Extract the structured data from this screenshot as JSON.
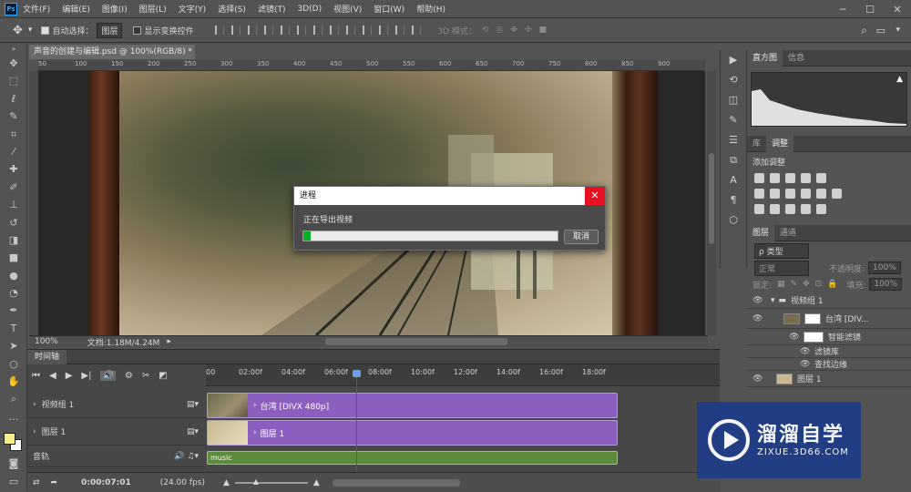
{
  "menubar": {
    "app_icon": "Ps",
    "items": [
      "文件(F)",
      "编辑(E)",
      "图像(I)",
      "图层(L)",
      "文字(Y)",
      "选择(S)",
      "滤镜(T)",
      "3D(D)",
      "视图(V)",
      "窗口(W)",
      "帮助(H)"
    ],
    "window_controls": [
      "─",
      "☐",
      "✕"
    ]
  },
  "options": {
    "auto_select_label": "自动选择：",
    "auto_select_value": "图层",
    "transform_label": "显示变换控件",
    "mode3d_label": "3D 模式："
  },
  "document": {
    "tab_title": "声音的创建与编辑.psd @ 100%(RGB/8) *",
    "tab_close": "×",
    "zoom": "100%",
    "docsize": "文档:1.18M/4.24M"
  },
  "ruler": {
    "marks": [
      "50",
      "100",
      "150",
      "200",
      "250",
      "300",
      "350",
      "400",
      "450",
      "500",
      "550",
      "600",
      "650",
      "700",
      "750",
      "800",
      "850",
      "900"
    ]
  },
  "dialog": {
    "title": "进程",
    "message": "正在导出视频",
    "progress": 0.03,
    "cancel_label": "取消",
    "close_icon": "✕"
  },
  "right_panel": {
    "tabs1": [
      "直方图",
      "信息"
    ],
    "tabs2": [
      "库",
      "调整"
    ],
    "adjust_label": "添加调整",
    "tabs3": [
      "图层",
      "通道"
    ],
    "kind_filter": "ρ 类型",
    "blend_mode": "正常",
    "opacity_label": "不透明度:",
    "opacity_value": "100%",
    "lock_label": "锁定:",
    "fill_label": "填充:",
    "fill_value": "100%",
    "layers": [
      {
        "name": "视频组 1",
        "type": "group"
      },
      {
        "name": "台湾 [DIV...",
        "type": "smart"
      },
      {
        "name": "智能滤镜",
        "type": "filter"
      },
      {
        "name": "滤镜库",
        "type": "filter-item"
      },
      {
        "name": "查找边缘",
        "type": "filter-item"
      },
      {
        "name": "图层 1",
        "type": "layer"
      }
    ]
  },
  "timeline": {
    "tab_label": "时间轴",
    "ticks": [
      "00",
      "02:00f",
      "04:00f",
      "06:00f",
      "08:00f",
      "10:00f",
      "12:00f",
      "14:00f",
      "16:00f",
      "18:00f"
    ],
    "tracks": [
      {
        "name": "视频组 1",
        "clip": "台湾 [DIVX 480p]"
      },
      {
        "name": "图层 1",
        "clip": "图层 1"
      },
      {
        "name": "音轨",
        "clip": "music"
      }
    ],
    "timecode": "0:00:07:01",
    "fps": "(24.00 fps)"
  },
  "watermark": {
    "main": "溜溜自学",
    "sub": "ZIXUE.3D66.COM"
  },
  "colors": {
    "accent_red": "#e81123",
    "progress_green": "#06b025",
    "video_clip": "#8b5fbf",
    "audio_clip": "#5e8a3c",
    "playhead": "#d22222",
    "watermark_bg": "#1f3c86",
    "foreground": "#f2ef8a",
    "background": "#ffffff"
  }
}
